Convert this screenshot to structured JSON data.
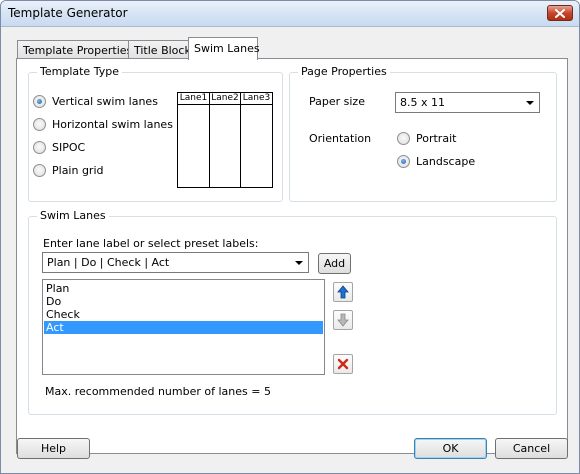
{
  "window": {
    "title": "Template Generator",
    "close_icon": "close-icon"
  },
  "tabs": [
    {
      "label": "Template Properties",
      "active": false
    },
    {
      "label": "Title Block",
      "active": false
    },
    {
      "label": "Swim Lanes",
      "active": true
    }
  ],
  "template_type": {
    "group_label": "Template Type",
    "options": [
      {
        "label": "Vertical swim lanes",
        "checked": true
      },
      {
        "label": "Horizontal swim lanes",
        "checked": false
      },
      {
        "label": "SIPOC",
        "checked": false
      },
      {
        "label": "Plain grid",
        "checked": false
      }
    ],
    "preview_lanes": [
      "Lane1",
      "Lane2",
      "Lane3"
    ]
  },
  "page_properties": {
    "group_label": "Page Properties",
    "paper_size_label": "Paper size",
    "paper_size_value": "8.5 x 11",
    "orientation_label": "Orientation",
    "orientation_options": [
      {
        "label": "Portrait",
        "checked": false
      },
      {
        "label": "Landscape",
        "checked": true
      }
    ]
  },
  "swim_lanes": {
    "group_label": "Swim Lanes",
    "instruction": "Enter lane label or select preset labels:",
    "preset_value": "Plan | Do | Check | Act",
    "add_label": "Add",
    "items": [
      "Plan",
      "Do",
      "Check",
      "Act"
    ],
    "selected_index": 3,
    "note": "Max. recommended number of lanes = 5",
    "move_up_icon": "arrow-up-icon",
    "move_down_icon": "arrow-down-icon",
    "delete_icon": "delete-icon"
  },
  "footer": {
    "help_label": "Help",
    "ok_label": "OK",
    "cancel_label": "Cancel"
  },
  "colors": {
    "selection": "#3399ff",
    "title_bar": "#d7e4f4",
    "close_button": "#c7462c"
  }
}
